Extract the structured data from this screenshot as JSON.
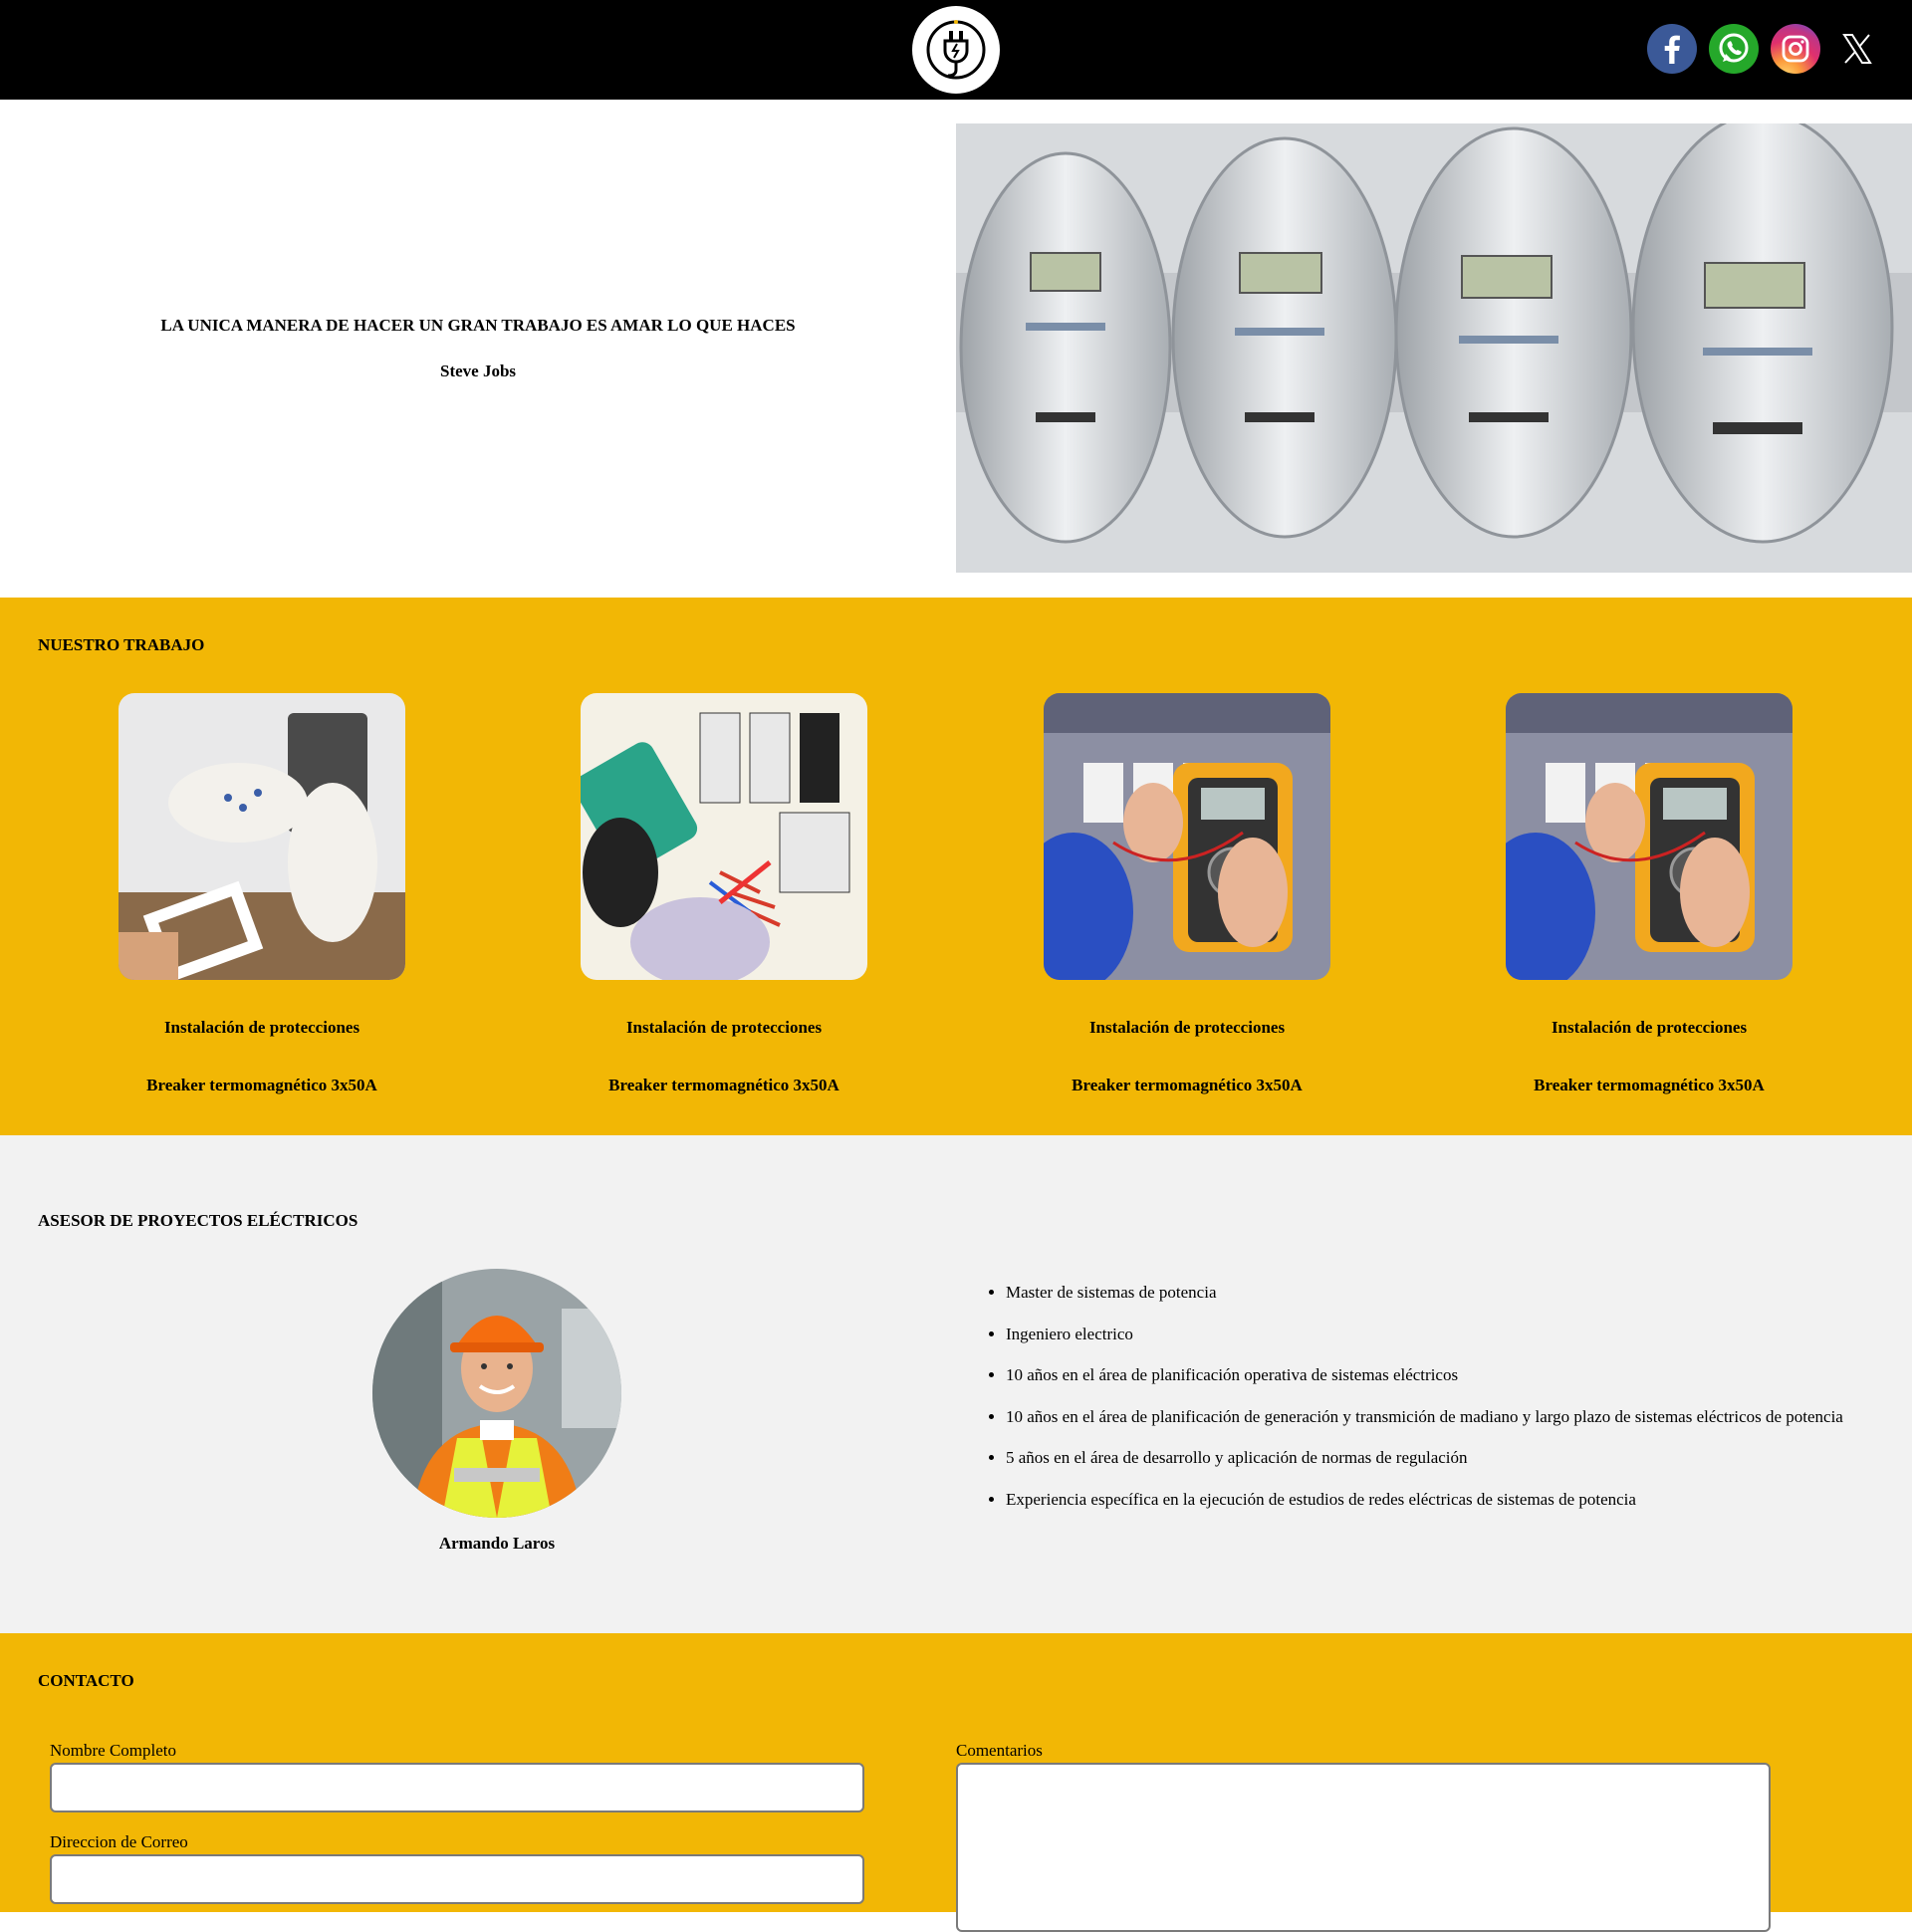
{
  "hero": {
    "quote": "LA UNICA MANERA DE HACER UN GRAN TRABAJO ES AMAR LO QUE HACES",
    "author": "Steve Jobs"
  },
  "work": {
    "title": "NUESTRO TRABAJO",
    "cards": [
      {
        "title": "Instalación de protecciones",
        "subtitle": "Breaker termomagnético 3x50A"
      },
      {
        "title": "Instalación de protecciones",
        "subtitle": "Breaker termomagnético 3x50A"
      },
      {
        "title": "Instalación de protecciones",
        "subtitle": "Breaker termomagnético 3x50A"
      },
      {
        "title": "Instalación de protecciones",
        "subtitle": "Breaker termomagnético 3x50A"
      }
    ]
  },
  "advisor": {
    "title": "ASESOR DE PROYECTOS ELÉCTRICOS",
    "name": "Armando Laros",
    "qualifications": [
      "Master de sistemas de potencia",
      "Ingeniero electrico",
      "10 años en el área de planificación operativa de sistemas eléctricos",
      "10 años en el área de planificación de generación y transmición de madiano y largo plazo de sistemas eléctricos de potencia",
      "5 años en el área de desarrollo y aplicación de normas de regulación",
      "Experiencia específica en la ejecución de estudios de redes eléctricas de sistemas de potencia"
    ]
  },
  "contact": {
    "title": "CONTACTO",
    "name_label": "Nombre Completo",
    "name_value": "",
    "email_label": "Direccion de Correo",
    "email_value": "",
    "comments_label": "Comentarios",
    "comments_value": ""
  },
  "colors": {
    "accent": "#f2b705",
    "header_bg": "#000000",
    "section_bg": "#f2f2f2"
  },
  "icons": {
    "logo": "plug-icon",
    "socials": [
      "facebook-icon",
      "whatsapp-icon",
      "instagram-icon",
      "x-icon"
    ]
  }
}
